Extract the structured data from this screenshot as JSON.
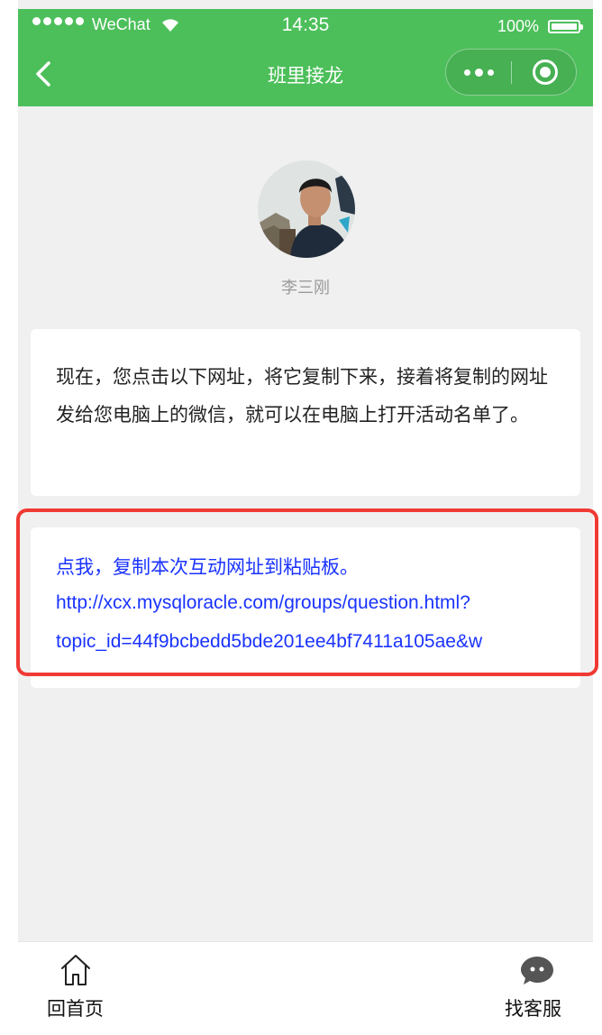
{
  "status_bar": {
    "carrier": "WeChat",
    "time": "14:35",
    "battery": "100%"
  },
  "nav": {
    "title": "班里接龙"
  },
  "profile": {
    "name": "李三刚"
  },
  "message": {
    "text": "现在，您点击以下网址，将它复制下来，接着将复制的网址发给您电脑上的微信，就可以在电脑上打开活动名单了。"
  },
  "link_card": {
    "copy_label": "点我，复制本次互动网址到粘贴板。",
    "url_line1": "http://xcx.mysqloracle.com/groups/question.html?",
    "url_line2": "topic_id=44f9bcbedd5bde201ee4bf7411a105ae&w"
  },
  "tabbar": {
    "home_label": "回首页",
    "service_label": "找客服"
  },
  "colors": {
    "header_green": "#4cbf5a",
    "link_blue": "#1a33ff",
    "highlight_red": "#f03a34"
  },
  "icons": [
    "back-arrow-icon",
    "more-dots-icon",
    "close-target-icon",
    "home-icon",
    "chat-bubble-icon",
    "wifi-icon",
    "battery-icon"
  ]
}
